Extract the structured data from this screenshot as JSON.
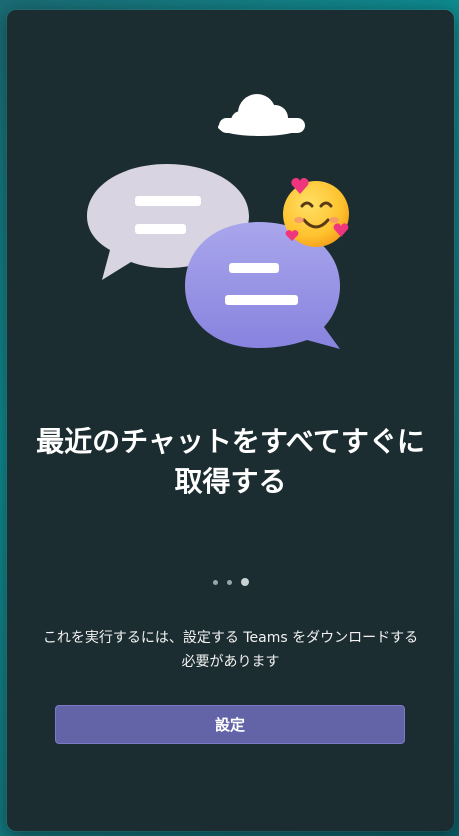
{
  "dialog": {
    "headline": "最近のチャットをすべてすぐに取得する",
    "body": "これを実行するには、設定する Teams をダウンロードする必要があります",
    "pager": {
      "total": 3,
      "active_index": 3
    },
    "setup_button_label": "設定"
  },
  "colors": {
    "panel_background": "#1c2d31",
    "button_accent": "#6264a7",
    "bubble_gray": "#d9d4e1",
    "bubble_purple": "#9b97e6"
  },
  "icons": [
    "cloud-icon",
    "chat-bubble-icon",
    "smiling-face-with-hearts-emoji-icon"
  ]
}
